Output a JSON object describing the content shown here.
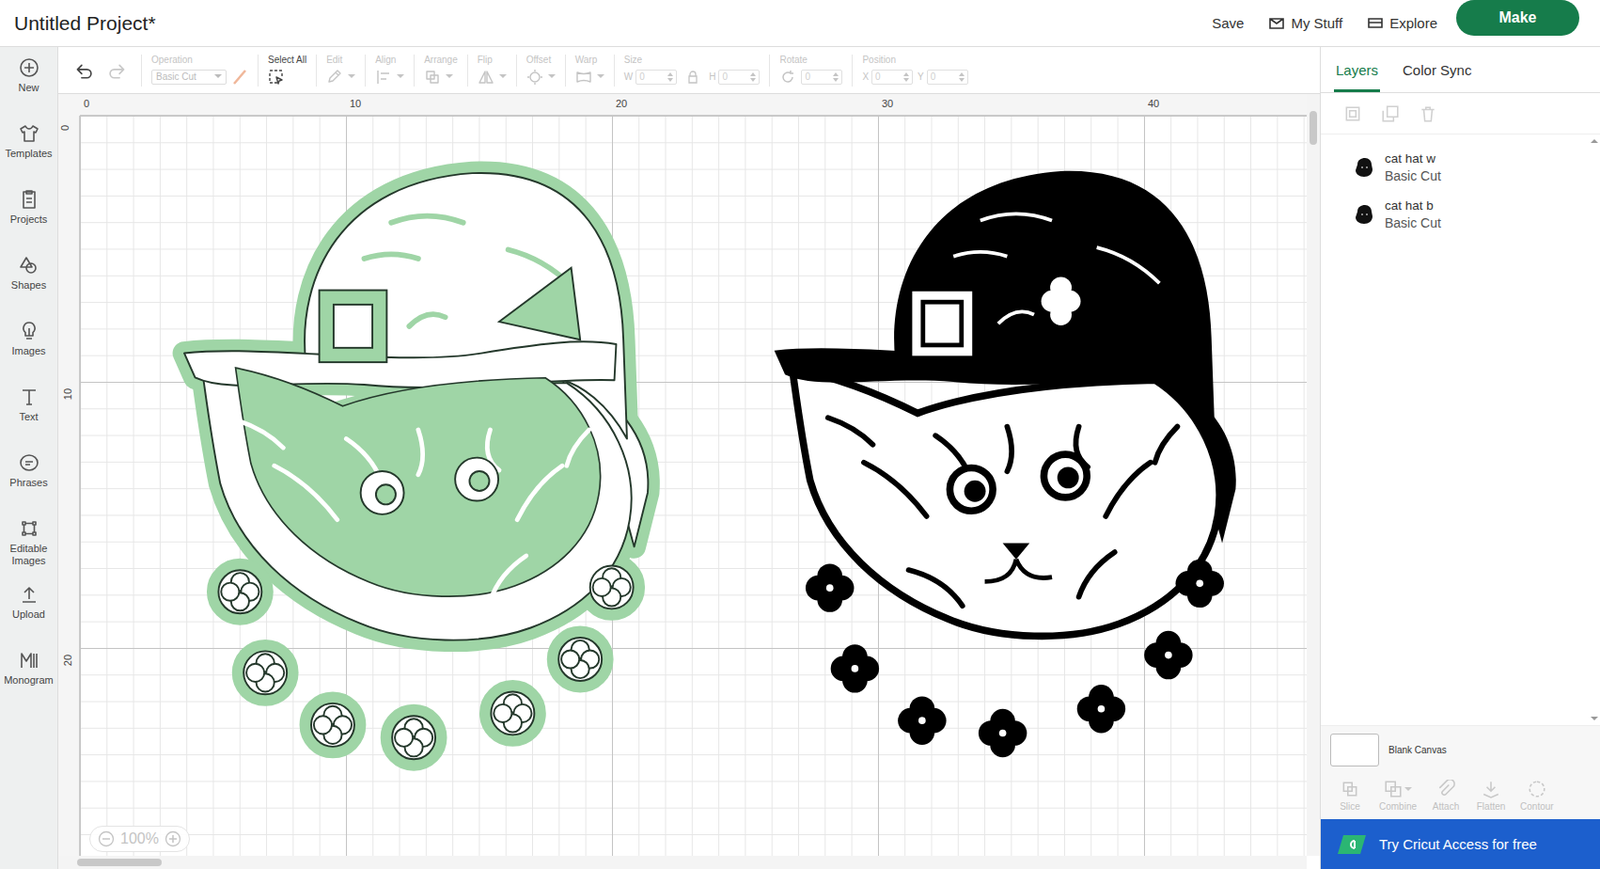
{
  "window": {
    "title": "Untitled Project*"
  },
  "header": {
    "links": [
      {
        "label": "Save",
        "kind": "plain"
      },
      {
        "label": "My Stuff",
        "kind": "stuff"
      },
      {
        "label": "Explore",
        "kind": "explore"
      }
    ],
    "make_button": "Make"
  },
  "sidebar": {
    "items": [
      {
        "label": "New"
      },
      {
        "label": "Templates"
      },
      {
        "label": "Projects"
      },
      {
        "label": "Shapes"
      },
      {
        "label": "Images"
      },
      {
        "label": "Text"
      },
      {
        "label": "Phrases"
      },
      {
        "label": "Editable Images"
      },
      {
        "label": "Upload"
      },
      {
        "label": "Monogram"
      }
    ]
  },
  "history": [
    {
      "kind": "undo",
      "disabled": false
    },
    {
      "kind": "redo",
      "disabled": true
    }
  ],
  "toolbar": {
    "items": [
      {
        "kind": "operation",
        "label": "Operation",
        "value": "Basic Cut",
        "disabled": true
      },
      {
        "kind": "selectall",
        "label": "Select All",
        "disabled": false
      },
      {
        "kind": "edit",
        "label": "Edit",
        "disabled": true
      },
      {
        "kind": "align",
        "label": "Align",
        "disabled": true
      },
      {
        "kind": "arrange",
        "label": "Arrange",
        "disabled": true
      },
      {
        "kind": "flip",
        "label": "Flip",
        "disabled": true
      },
      {
        "kind": "offset",
        "label": "Offset",
        "disabled": true
      },
      {
        "kind": "warp",
        "label": "Warp",
        "disabled": true
      },
      {
        "kind": "size",
        "label": "Size",
        "disabled": true,
        "fields": [
          {
            "prefix": "W",
            "value": "0"
          },
          {
            "prefix": "H",
            "value": "0"
          }
        ]
      },
      {
        "kind": "rotate",
        "label": "Rotate",
        "disabled": true,
        "fields": [
          {
            "prefix": "",
            "value": "0"
          }
        ]
      },
      {
        "kind": "position",
        "label": "Position",
        "disabled": true,
        "fields": [
          {
            "prefix": "X",
            "value": "0"
          },
          {
            "prefix": "Y",
            "value": "0"
          }
        ]
      }
    ]
  },
  "rulers": {
    "top": [
      "0",
      "10",
      "20",
      "30",
      "40"
    ],
    "left": [
      "0",
      "10",
      "20"
    ]
  },
  "zoom": {
    "value": "100%",
    "disabled": true
  },
  "panel": {
    "tabs": [
      {
        "label": "Layers",
        "selected": true
      },
      {
        "label": "Color Sync",
        "selected": false
      }
    ],
    "tools": [
      {
        "kind": "group",
        "disabled": true
      },
      {
        "kind": "duplicate",
        "disabled": true
      },
      {
        "kind": "delete",
        "disabled": true
      }
    ],
    "layers": [
      {
        "name": "cat hat w",
        "operation": "Basic Cut",
        "selected": false,
        "color": "#9fd5a6",
        "kind": "contour"
      },
      {
        "name": "cat hat b",
        "operation": "Basic Cut",
        "selected": false,
        "color": "#000000",
        "kind": "solid"
      }
    ],
    "canvas": {
      "label": "Blank Canvas",
      "color": "#ffffff"
    },
    "actions": [
      {
        "kind": "slice",
        "label": "Slice",
        "disabled": true
      },
      {
        "kind": "combine",
        "label": "Combine",
        "disabled": true
      },
      {
        "kind": "attach",
        "label": "Attach",
        "disabled": true
      },
      {
        "kind": "flatten",
        "label": "Flatten",
        "disabled": true
      },
      {
        "kind": "contour",
        "label": "Contour",
        "disabled": true
      }
    ]
  },
  "banner": {
    "text": "Try Cricut Access for free"
  }
}
